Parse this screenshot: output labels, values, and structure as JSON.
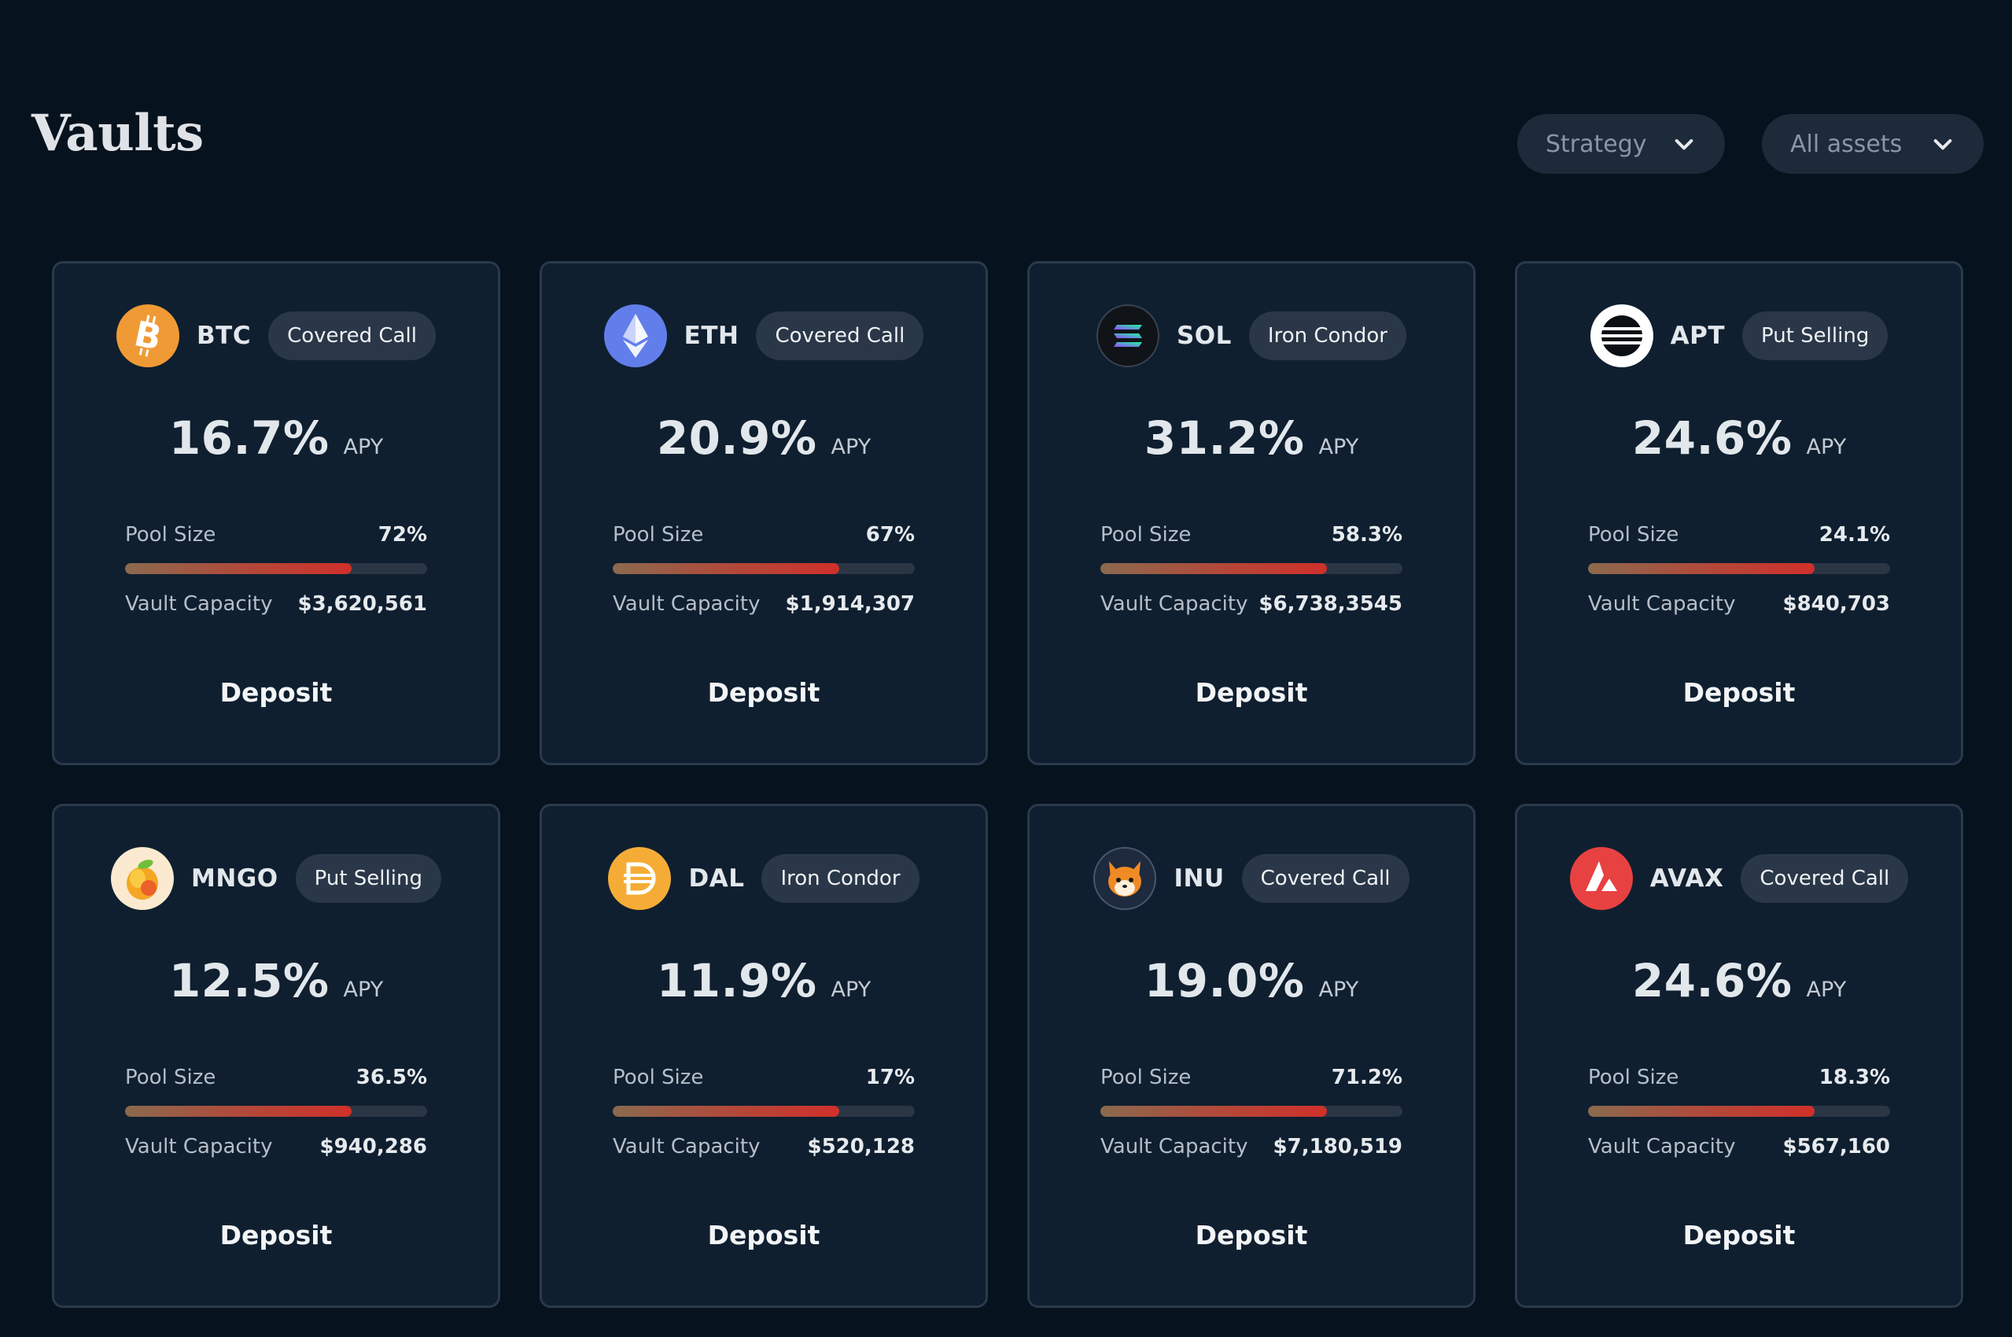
{
  "header": {
    "title": "Vaults",
    "filters": {
      "strategy_label": "Strategy",
      "assets_label": "All assets"
    }
  },
  "common": {
    "apy_unit": "APY",
    "pool_size_label": "Pool Size",
    "vault_capacity_label": "Vault Capacity",
    "deposit_label": "Deposit"
  },
  "vaults": [
    {
      "ticker": "BTC",
      "strategy": "Covered Call",
      "apy": "16.7%",
      "pool_size": "72%",
      "pool_fill": 0.75,
      "capacity": "$3,620,561",
      "icon": "bitcoin-icon",
      "icon_color": "#f09a35"
    },
    {
      "ticker": "ETH",
      "strategy": "Covered Call",
      "apy": "20.9%",
      "pool_size": "67%",
      "pool_fill": 0.75,
      "capacity": "$1,914,307",
      "icon": "ethereum-icon",
      "icon_color": "#627eea"
    },
    {
      "ticker": "SOL",
      "strategy": "Iron Condor",
      "apy": "31.2%",
      "pool_size": "58.3%",
      "pool_fill": 0.75,
      "capacity": "$6,738,3545",
      "icon": "solana-icon",
      "icon_color": "#101418"
    },
    {
      "ticker": "APT",
      "strategy": "Put Selling",
      "apy": "24.6%",
      "pool_size": "24.1%",
      "pool_fill": 0.75,
      "capacity": "$840,703",
      "icon": "aptos-icon",
      "icon_color": "#ffffff"
    },
    {
      "ticker": "MNGO",
      "strategy": "Put Selling",
      "apy": "12.5%",
      "pool_size": "36.5%",
      "pool_fill": 0.75,
      "capacity": "$940,286",
      "icon": "mango-icon",
      "icon_color": "#fbead0"
    },
    {
      "ticker": "DAL",
      "strategy": "Iron Condor",
      "apy": "11.9%",
      "pool_size": "17%",
      "pool_fill": 0.75,
      "capacity": "$520,128",
      "icon": "dai-icon",
      "icon_color": "#f5ac37"
    },
    {
      "ticker": "INU",
      "strategy": "Covered Call",
      "apy": "19.0%",
      "pool_size": "71.2%",
      "pool_fill": 0.75,
      "capacity": "$7,180,519",
      "icon": "shiba-inu-icon",
      "icon_color": "#1e2a3e"
    },
    {
      "ticker": "AVAX",
      "strategy": "Covered Call",
      "apy": "24.6%",
      "pool_size": "18.3%",
      "pool_fill": 0.75,
      "capacity": "$567,160",
      "icon": "avalanche-icon",
      "icon_color": "#e84142"
    }
  ]
}
